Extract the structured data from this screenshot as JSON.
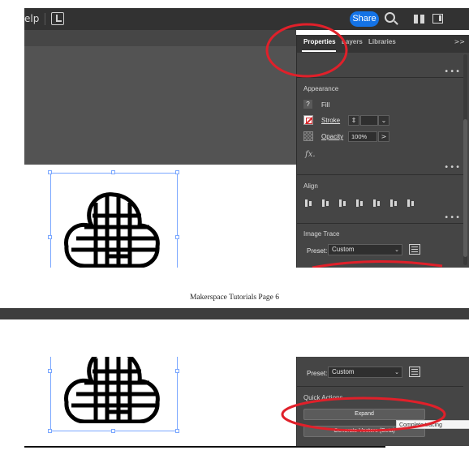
{
  "top": {
    "menu_fragment": "elp",
    "share_label": "Share",
    "icons": [
      "arrange-documents-icon",
      "search-icon",
      "workspace-switcher-icon",
      "panel-toggle-icon"
    ],
    "tabs": [
      {
        "label": "Properties",
        "active": true
      },
      {
        "label": "Layers",
        "active": false
      },
      {
        "label": "Libraries",
        "active": false
      }
    ],
    "tabs_overflow": ">>",
    "more": "•••",
    "appearance": {
      "title": "Appearance",
      "fill_badge": "?",
      "fill_label": "Fill",
      "stroke_label": "Stroke",
      "stroke_arrow": "⌄",
      "opacity_label": "Opacity",
      "opacity_value": "100%",
      "opacity_arrow": ">",
      "fx_label": "fx."
    },
    "align": {
      "title": "Align"
    },
    "image_trace": {
      "title": "Image Trace",
      "preset_label": "Preset:",
      "preset_value": "Custom"
    }
  },
  "caption": "Makerspace Tutorials Page 6",
  "bottom": {
    "preset_label": "Preset:",
    "preset_value": "Custom",
    "quick_actions_title": "Quick Actions",
    "expand_label": "Expand",
    "generate_label": "Generate Vectors (Beta)",
    "tooltip": "Complete tracing"
  },
  "colors": {
    "annotation_red": "#e0202a",
    "share_blue": "#1473e6",
    "selection_blue": "#7aa7ff",
    "panel_bg": "#454545"
  }
}
